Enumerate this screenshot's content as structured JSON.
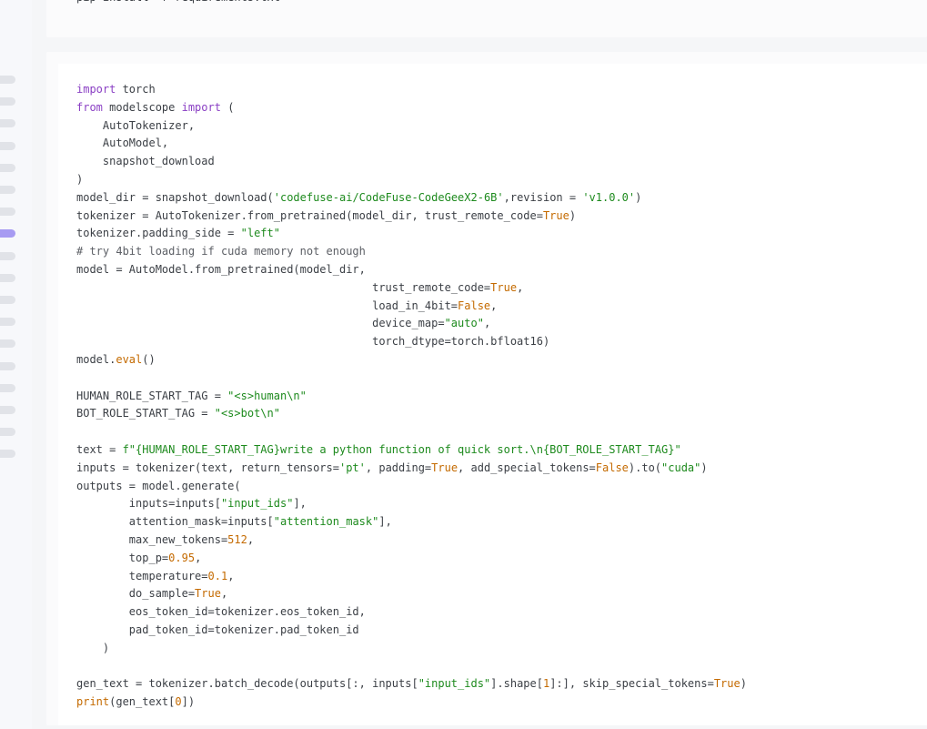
{
  "toc": {
    "marker_count": 18,
    "active_index": 7
  },
  "install_block": {
    "lines": [
      [
        {
          "t": "pip install -r requirements.txt",
          "c": ""
        }
      ]
    ]
  },
  "code_block": {
    "lines": [
      [
        {
          "t": "import",
          "c": "kw"
        },
        {
          "t": " torch",
          "c": ""
        }
      ],
      [
        {
          "t": "from",
          "c": "kw"
        },
        {
          "t": " modelscope ",
          "c": ""
        },
        {
          "t": "import",
          "c": "kw"
        },
        {
          "t": " (",
          "c": ""
        }
      ],
      [
        {
          "t": "    AutoTokenizer,",
          "c": ""
        }
      ],
      [
        {
          "t": "    AutoModel,",
          "c": ""
        }
      ],
      [
        {
          "t": "    snapshot_download",
          "c": ""
        }
      ],
      [
        {
          "t": ")",
          "c": ""
        }
      ],
      [
        {
          "t": "model_dir = snapshot_download(",
          "c": ""
        },
        {
          "t": "'codefuse-ai/CodeFuse-CodeGeeX2-6B'",
          "c": "str"
        },
        {
          "t": ",revision = ",
          "c": ""
        },
        {
          "t": "'v1.0.0'",
          "c": "str"
        },
        {
          "t": ")",
          "c": ""
        }
      ],
      [
        {
          "t": "tokenizer = AutoTokenizer.from_pretrained(model_dir, trust_remote_code=",
          "c": ""
        },
        {
          "t": "True",
          "c": "lit"
        },
        {
          "t": ")",
          "c": ""
        }
      ],
      [
        {
          "t": "tokenizer.padding_side = ",
          "c": ""
        },
        {
          "t": "\"left\"",
          "c": "str"
        }
      ],
      [
        {
          "t": "# try 4bit loading if cuda memory not enough",
          "c": "cmt"
        }
      ],
      [
        {
          "t": "model = AutoModel.from_pretrained(model_dir,",
          "c": ""
        }
      ],
      [
        {
          "t": "                                             trust_remote_code=",
          "c": ""
        },
        {
          "t": "True",
          "c": "lit"
        },
        {
          "t": ",",
          "c": ""
        }
      ],
      [
        {
          "t": "                                             load_in_4bit=",
          "c": ""
        },
        {
          "t": "False",
          "c": "lit"
        },
        {
          "t": ",",
          "c": ""
        }
      ],
      [
        {
          "t": "                                             device_map=",
          "c": ""
        },
        {
          "t": "\"auto\"",
          "c": "str"
        },
        {
          "t": ",",
          "c": ""
        }
      ],
      [
        {
          "t": "                                             torch_dtype=torch.bfloat16)",
          "c": ""
        }
      ],
      [
        {
          "t": "model.",
          "c": ""
        },
        {
          "t": "eval",
          "c": "lit"
        },
        {
          "t": "()",
          "c": ""
        }
      ],
      [
        {
          "t": "",
          "c": ""
        }
      ],
      [
        {
          "t": "HUMAN_ROLE_START_TAG = ",
          "c": ""
        },
        {
          "t": "\"<s>human\\n\"",
          "c": "str"
        }
      ],
      [
        {
          "t": "BOT_ROLE_START_TAG = ",
          "c": ""
        },
        {
          "t": "\"<s>bot\\n\"",
          "c": "str"
        }
      ],
      [
        {
          "t": "",
          "c": ""
        }
      ],
      [
        {
          "t": "text = ",
          "c": ""
        },
        {
          "t": "f\"{HUMAN_ROLE_START_TAG}write a python function of quick sort.\\n{BOT_ROLE_START_TAG}\"",
          "c": "str"
        }
      ],
      [
        {
          "t": "inputs = tokenizer(text, return_tensors=",
          "c": ""
        },
        {
          "t": "'pt'",
          "c": "str"
        },
        {
          "t": ", padding=",
          "c": ""
        },
        {
          "t": "True",
          "c": "lit"
        },
        {
          "t": ", add_special_tokens=",
          "c": ""
        },
        {
          "t": "False",
          "c": "lit"
        },
        {
          "t": ").to(",
          "c": ""
        },
        {
          "t": "\"cuda\"",
          "c": "str"
        },
        {
          "t": ")",
          "c": ""
        }
      ],
      [
        {
          "t": "outputs = model.generate(",
          "c": ""
        }
      ],
      [
        {
          "t": "        inputs=inputs[",
          "c": ""
        },
        {
          "t": "\"input_ids\"",
          "c": "str"
        },
        {
          "t": "],",
          "c": ""
        }
      ],
      [
        {
          "t": "        attention_mask=inputs[",
          "c": ""
        },
        {
          "t": "\"attention_mask\"",
          "c": "str"
        },
        {
          "t": "],",
          "c": ""
        }
      ],
      [
        {
          "t": "        max_new_tokens=",
          "c": ""
        },
        {
          "t": "512",
          "c": "num"
        },
        {
          "t": ",",
          "c": ""
        }
      ],
      [
        {
          "t": "        top_p=",
          "c": ""
        },
        {
          "t": "0.95",
          "c": "num"
        },
        {
          "t": ",",
          "c": ""
        }
      ],
      [
        {
          "t": "        temperature=",
          "c": ""
        },
        {
          "t": "0.1",
          "c": "num"
        },
        {
          "t": ",",
          "c": ""
        }
      ],
      [
        {
          "t": "        do_sample=",
          "c": ""
        },
        {
          "t": "True",
          "c": "lit"
        },
        {
          "t": ",",
          "c": ""
        }
      ],
      [
        {
          "t": "        eos_token_id=tokenizer.eos_token_id,",
          "c": ""
        }
      ],
      [
        {
          "t": "        pad_token_id=tokenizer.pad_token_id",
          "c": ""
        }
      ],
      [
        {
          "t": "    )",
          "c": ""
        }
      ],
      [
        {
          "t": "",
          "c": ""
        }
      ],
      [
        {
          "t": "gen_text = tokenizer.batch_decode(outputs[:, inputs[",
          "c": ""
        },
        {
          "t": "\"input_ids\"",
          "c": "str"
        },
        {
          "t": "].shape[",
          "c": ""
        },
        {
          "t": "1",
          "c": "num"
        },
        {
          "t": "]:], skip_special_tokens=",
          "c": ""
        },
        {
          "t": "True",
          "c": "lit"
        },
        {
          "t": ")",
          "c": ""
        }
      ],
      [
        {
          "t": "print",
          "c": "lit"
        },
        {
          "t": "(gen_text[",
          "c": ""
        },
        {
          "t": "0",
          "c": "num"
        },
        {
          "t": "])",
          "c": ""
        }
      ]
    ]
  }
}
